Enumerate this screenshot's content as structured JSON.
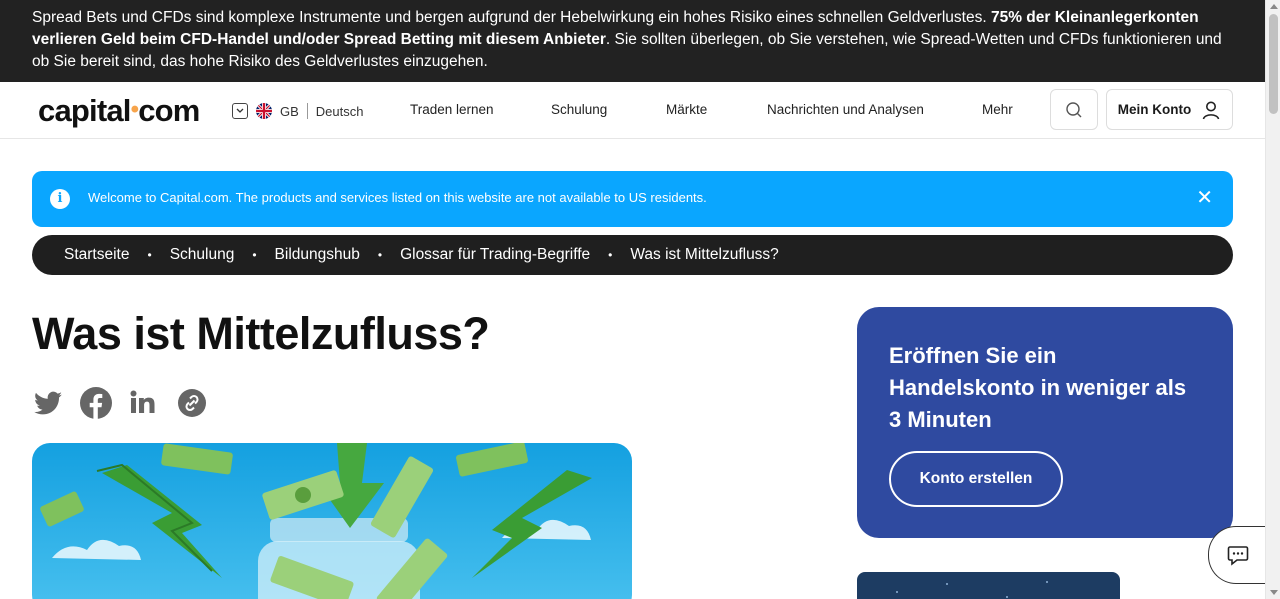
{
  "risk_banner": {
    "text_a": "Spread Bets und CFDs sind komplexe Instrumente und bergen aufgrund der Hebelwirkung ein hohes Risiko eines schnellen Geldverlustes. ",
    "text_bold": "75% der Kleinanlegerkonten verlieren Geld beim CFD-Handel und/oder Spread Betting mit diesem Anbieter",
    "text_b": ". Sie sollten überlegen, ob Sie verstehen, wie Spread-Wetten und CFDs funktionieren und ob Sie bereit sind, das hohe Risiko des Geldverlustes einzugehen."
  },
  "header": {
    "logo_left": "capital",
    "logo_dot": "•",
    "logo_right": "com",
    "region": "GB",
    "language": "Deutsch",
    "nav": [
      "Traden lernen",
      "Schulung",
      "Märkte",
      "Nachrichten und Analysen",
      "Mehr"
    ],
    "account_label": "Mein Konto"
  },
  "notice": {
    "icon_text": "i",
    "message": "Welcome to Capital.com. The products and services listed on this website are not available to US residents.",
    "close": "✕"
  },
  "breadcrumb": {
    "items": [
      "Startseite",
      "Schulung",
      "Bildungshub",
      "Glossar für Trading-Begriffe",
      "Was ist Mittelzufluss?"
    ],
    "separator": "•"
  },
  "page": {
    "title": "Was ist Mittelzufluss?",
    "share_icons": [
      "twitter-icon",
      "facebook-icon",
      "linkedin-icon",
      "copy-link-icon"
    ]
  },
  "promo": {
    "heading": "Eröffnen Sie ein Handelskonto in weniger als 3 Minuten",
    "button": "Konto erstellen"
  },
  "colors": {
    "banner_bg": "#222222",
    "notice_bg": "#0aa6ff",
    "promo_bg": "#2f4aa0",
    "logo_dot": "#f7a44b",
    "share_icon": "#666666"
  }
}
